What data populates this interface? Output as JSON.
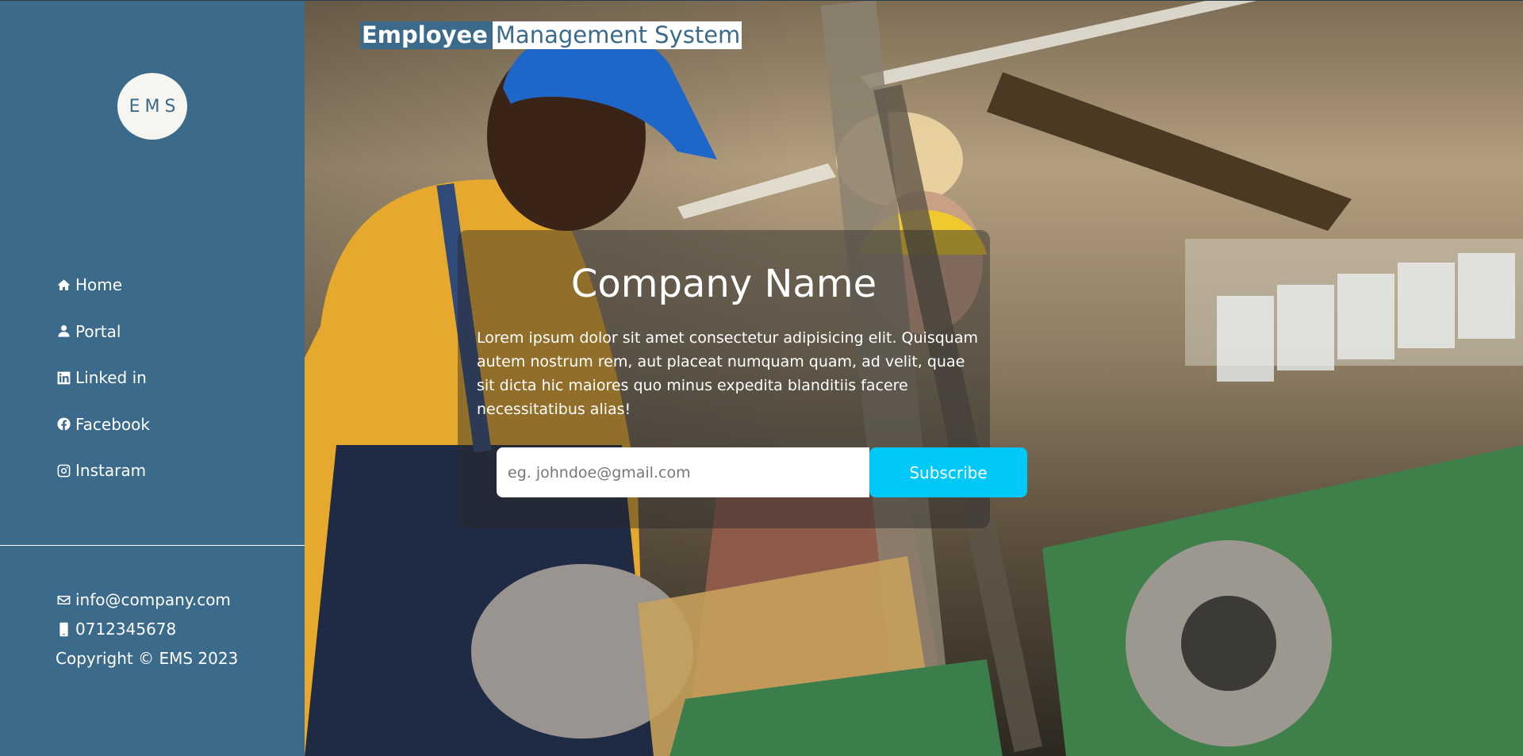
{
  "brand": {
    "logo_text": "EMS",
    "title_bold": "Employee",
    "title_rest": "Management System"
  },
  "nav": [
    {
      "label": "Home",
      "icon": "home-icon"
    },
    {
      "label": "Portal",
      "icon": "user-icon"
    },
    {
      "label": "Linked in",
      "icon": "linkedin-icon"
    },
    {
      "label": "Facebook",
      "icon": "facebook-icon"
    },
    {
      "label": "Instaram",
      "icon": "instagram-icon"
    }
  ],
  "contact": {
    "email": "info@company.com",
    "phone": "0712345678",
    "copyright": "Copyright © EMS 2023"
  },
  "hero": {
    "heading": "Company Name",
    "body": "Lorem ipsum dolor sit amet consectetur adipisicing elit. Quisquam autem nostrum rem, aut placeat numquam quam, ad velit, quae sit dicta hic maiores quo minus expedita blanditiis facere necessitatibus alias!",
    "email_placeholder": "eg. johndoe@gmail.com",
    "subscribe_label": "Subscribe"
  },
  "colors": {
    "sidebar": "#3b6a8a",
    "accent": "#00c8f8",
    "logo_bg": "#f7f5f0"
  }
}
